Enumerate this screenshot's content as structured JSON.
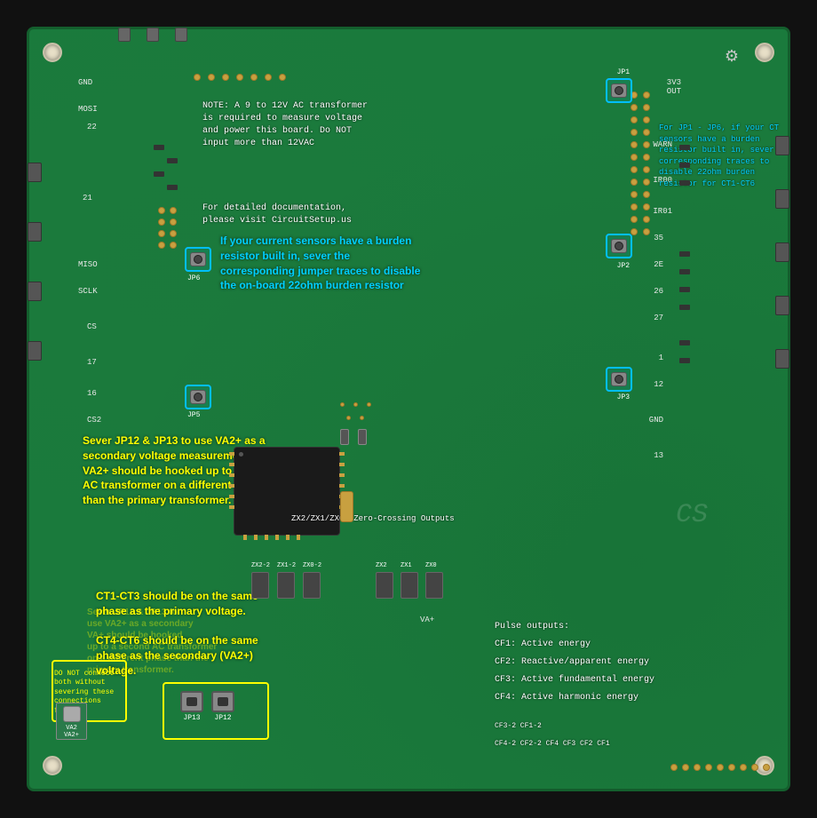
{
  "board": {
    "background_color": "#1b6b3a",
    "note_text": "NOTE: A 9 to 12V AC\ntransformer is required to\nmeasure voltage and power\nthis board. Do NOT input\nmore than 12VAC",
    "doc_text": "For detailed documentation,\nplease visit CircuitSetup.us",
    "annotation_blue_1": "If your current sensors have a\nburden resistor built in, sever\nthe corresponding jumper traces\nto disable the on-board 22ohm\nburden resistor",
    "annotation_yellow_1": "Sever JP12  & JP13 to\nuse VA2+ as a secondary\nvoltage measurement input.\nVA2+ should be hooked\nup to a second AC transformer\non a different phase than the\nprimary transformer.",
    "annotation_yellow_2": "CT1-CT3 should be on the same\nphase as the primary voltage.",
    "annotation_yellow_3": "CT4-CT6 should be on the\nsame phase as the secondary\n(VA2+) voltage.",
    "annotation_blue_2": "For JP1 - JP6, if your CT\nsensors have a burden\nresistor built in,\nsever corresponding\ntraces to disable\n22ohm burden\nresistor for\nCT1-CT6",
    "do_not_connect": "DO NOT connect both\nwithout severing these\nconnections first!",
    "pulse_outputs": "Pulse outputs:",
    "cf1": "CF1: Active energy",
    "cf2": "CF2: Reactive/apparent energy",
    "cf3": "CF3: Active fundamental energy",
    "cf4": "CF4: Active harmonic energy",
    "cf32": "CF3-2  CF1-2",
    "cf42": "CF4-2  CF2-2    CF4 CF3 CF2 CF1",
    "zx_label": "ZX2/ZX1/ZX0:\nZero-Crossing Outputs",
    "jp1_label": "JP1",
    "jp2_label": "JP2",
    "jp3_label": "JP3",
    "jp5_label": "JP5",
    "jp6_label": "JP6",
    "jp12_label": "JP12",
    "jp13_label": "JP13",
    "gnd_label": "GND",
    "warn_label": "WARN",
    "ir00_label": "IR00",
    "ir01_label": "IR01",
    "cs2_label": "CS2",
    "mosi_label": "MOSI",
    "miso_label": "MISO",
    "sclk_label": "SCLK",
    "cs_label": "CS",
    "gnd2_label": "GND",
    "three_v3_label": "3V3\nOUT",
    "va_label": "VA+"
  }
}
